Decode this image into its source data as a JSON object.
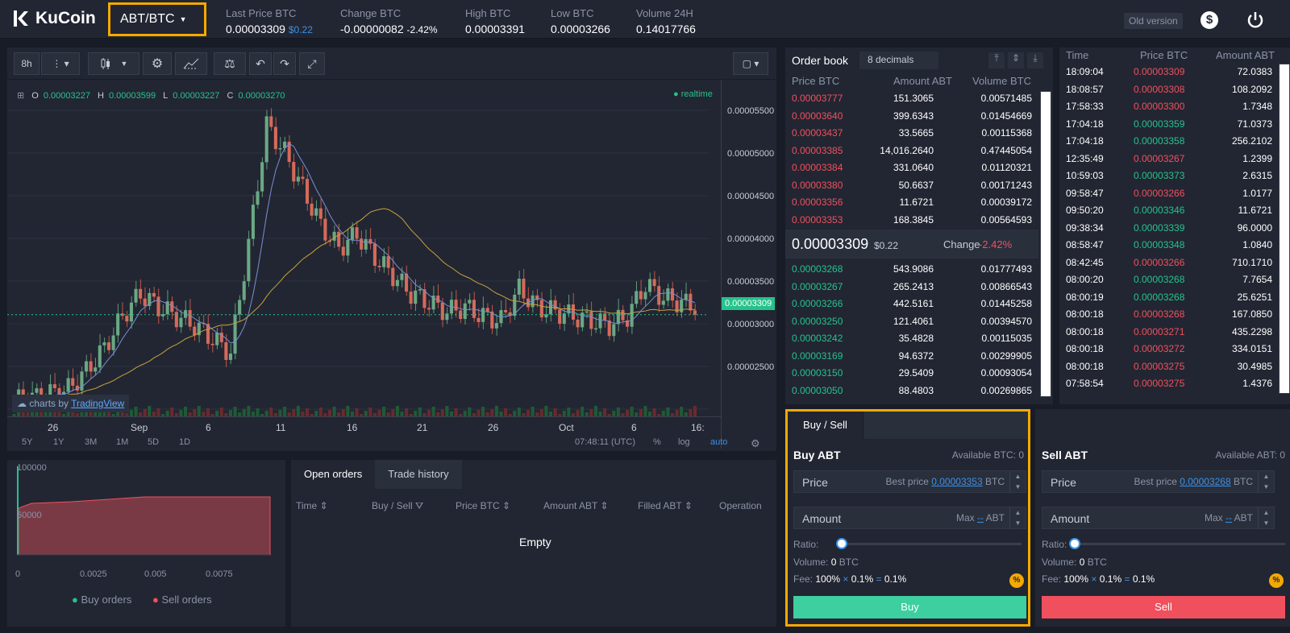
{
  "header": {
    "logo_text": "KuCoin",
    "pair": "ABT/BTC",
    "stats": [
      {
        "label": "Last Price BTC",
        "value": "0.00003309",
        "sub": "$0.22",
        "color": "#ffffff"
      },
      {
        "label": "Change BTC",
        "value": "-0.00000082",
        "sub": "-2.42%",
        "color": "#f0505e"
      },
      {
        "label": "High BTC",
        "value": "0.00003391",
        "sub": "",
        "color": "#26c28c"
      },
      {
        "label": "Low BTC",
        "value": "0.00003266",
        "sub": "",
        "color": "#f0505e"
      },
      {
        "label": "Volume 24H",
        "value": "0.14017766",
        "sub": "",
        "color": "#ffffff"
      }
    ],
    "old_version": "Old version",
    "dollar_icon": "$"
  },
  "chart": {
    "interval": "8h",
    "ohlc": {
      "o_label": "O",
      "o": "0.00003227",
      "h_label": "H",
      "h": "0.00003599",
      "l_label": "L",
      "l": "0.00003227",
      "c_label": "C",
      "c": "0.00003270"
    },
    "realtime": "realtime",
    "price_axis": [
      "0.00005500",
      "0.00005000",
      "0.00004500",
      "0.00004000",
      "0.00003500",
      "0.00003000",
      "0.00002500"
    ],
    "current_price": "0.00003309",
    "tv_text": "charts by",
    "tv_link": "TradingView",
    "x_axis": [
      "26",
      "Sep",
      "6",
      "11",
      "16",
      "21",
      "26",
      "Oct",
      "6",
      "16:"
    ],
    "ranges": [
      "5Y",
      "1Y",
      "3M",
      "1M",
      "5D",
      "1D"
    ],
    "time": "07:48:11 (UTC)",
    "pct": "%",
    "log": "log",
    "auto": "auto"
  },
  "chart_data": {
    "type": "line",
    "title": "",
    "ylim": [
      2.1e-05,
      5.8e-05
    ],
    "series": [
      {
        "name": "",
        "values": [
          2.27e-05,
          2.3e-05,
          2.35e-05,
          2.4e-05,
          2.6e-05,
          2.85e-05,
          3.2e-05,
          3.45e-05,
          3.3e-05,
          3.2e-05,
          3.1e-05,
          2.95e-05,
          2.8e-05,
          4e-05,
          5.3e-05,
          5e-05,
          4.6e-05,
          4.2e-05,
          3.95e-05,
          4.1e-05,
          3.85e-05,
          3.65e-05,
          3.45e-05,
          3.35e-05,
          3.25e-05,
          3.3e-05,
          3.2e-05,
          3.15e-05,
          3.5e-05,
          3.3e-05,
          3.25e-05,
          3.2e-05,
          3.15e-05,
          3.1e-05,
          3.2e-05,
          3.55e-05,
          3.4e-05,
          3.35e-05,
          3.3e-05
        ]
      }
    ]
  },
  "depth": {
    "y_top": "100000",
    "y_mid": "50000",
    "x_ticks": [
      "0",
      "0.0025",
      "0.005",
      "0.0075"
    ],
    "legend_buy": "Buy orders",
    "legend_sell": "Sell orders"
  },
  "orders": {
    "tabs": [
      "Open orders",
      "Trade history"
    ],
    "columns": [
      "Time",
      "Buy / Sell",
      "Price BTC",
      "Amount ABT",
      "Filled ABT",
      "Operation"
    ],
    "empty": "Empty"
  },
  "orderbook": {
    "title": "Order book",
    "decimals": "8 decimals",
    "headers": [
      "Price BTC",
      "Amount ABT",
      "Volume BTC"
    ],
    "asks": [
      [
        "0.00003777",
        "151.3065",
        "0.00571485"
      ],
      [
        "0.00003640",
        "399.6343",
        "0.01454669"
      ],
      [
        "0.00003437",
        "33.5665",
        "0.00115368"
      ],
      [
        "0.00003385",
        "14,016.2640",
        "0.47445054"
      ],
      [
        "0.00003384",
        "331.0640",
        "0.01120321"
      ],
      [
        "0.00003380",
        "50.6637",
        "0.00171243"
      ],
      [
        "0.00003356",
        "11.6721",
        "0.00039172"
      ],
      [
        "0.00003353",
        "168.3845",
        "0.00564593"
      ]
    ],
    "mid_price": "0.00003309",
    "mid_usd": "$0.22",
    "change_label": "Change",
    "change": "-2.42%",
    "bids": [
      [
        "0.00003268",
        "543.9086",
        "0.01777493"
      ],
      [
        "0.00003267",
        "265.2413",
        "0.00866543"
      ],
      [
        "0.00003266",
        "442.5161",
        "0.01445258"
      ],
      [
        "0.00003250",
        "121.4061",
        "0.00394570"
      ],
      [
        "0.00003242",
        "35.4828",
        "0.00115035"
      ],
      [
        "0.00003169",
        "94.6372",
        "0.00299905"
      ],
      [
        "0.00003150",
        "29.5409",
        "0.00093054"
      ],
      [
        "0.00003050",
        "88.4803",
        "0.00269865"
      ]
    ]
  },
  "trades": {
    "headers": [
      "Time",
      "Price BTC",
      "Amount ABT"
    ],
    "rows": [
      [
        "18:09:04",
        "0.00003309",
        "72.0383",
        "sell"
      ],
      [
        "18:08:57",
        "0.00003308",
        "108.2092",
        "sell"
      ],
      [
        "17:58:33",
        "0.00003300",
        "1.7348",
        "sell"
      ],
      [
        "17:04:18",
        "0.00003359",
        "71.0373",
        "buy"
      ],
      [
        "17:04:18",
        "0.00003358",
        "256.2102",
        "buy"
      ],
      [
        "12:35:49",
        "0.00003267",
        "1.2399",
        "sell"
      ],
      [
        "10:59:03",
        "0.00003373",
        "2.6315",
        "buy"
      ],
      [
        "09:58:47",
        "0.00003266",
        "1.0177",
        "sell"
      ],
      [
        "09:50:20",
        "0.00003346",
        "11.6721",
        "buy"
      ],
      [
        "09:38:34",
        "0.00003339",
        "96.0000",
        "buy"
      ],
      [
        "08:58:47",
        "0.00003348",
        "1.0840",
        "buy"
      ],
      [
        "08:42:45",
        "0.00003266",
        "710.1710",
        "sell"
      ],
      [
        "08:00:20",
        "0.00003268",
        "7.7654",
        "buy"
      ],
      [
        "08:00:19",
        "0.00003268",
        "25.6251",
        "buy"
      ],
      [
        "08:00:18",
        "0.00003268",
        "167.0850",
        "sell"
      ],
      [
        "08:00:18",
        "0.00003271",
        "435.2298",
        "sell"
      ],
      [
        "08:00:18",
        "0.00003272",
        "334.0151",
        "sell"
      ],
      [
        "08:00:18",
        "0.00003275",
        "30.4985",
        "sell"
      ],
      [
        "07:58:54",
        "0.00003275",
        "1.4376",
        "sell"
      ]
    ]
  },
  "buy": {
    "tab": "Buy / Sell",
    "title": "Buy ABT",
    "available": "Available BTC: 0",
    "price_ph": "Price",
    "best_label": "Best price",
    "best_value": "0.00003353",
    "best_unit": "BTC",
    "amount_ph": "Amount",
    "max_label": "Max",
    "max_value": "--",
    "max_unit": "ABT",
    "ratio": "Ratio:",
    "volume_label": "Volume:",
    "volume_value": "0",
    "volume_unit": "BTC",
    "fee_label": "Fee:",
    "fee_a": "100%",
    "fee_b": "0.1%",
    "fee_c": "0.1%",
    "button": "Buy",
    "color": "#3dcfa0"
  },
  "sell": {
    "title": "Sell ABT",
    "available": "Available ABT: 0",
    "price_ph": "Price",
    "best_label": "Best price",
    "best_value": "0.00003268",
    "best_unit": "BTC",
    "amount_ph": "Amount",
    "max_label": "Max",
    "max_value": "--",
    "max_unit": "ABT",
    "ratio": "Ratio:",
    "volume_label": "Volume:",
    "volume_value": "0",
    "volume_unit": "BTC",
    "fee_label": "Fee:",
    "fee_a": "100%",
    "fee_b": "0.1%",
    "fee_c": "0.1%",
    "button": "Sell",
    "color": "#f0505e"
  }
}
